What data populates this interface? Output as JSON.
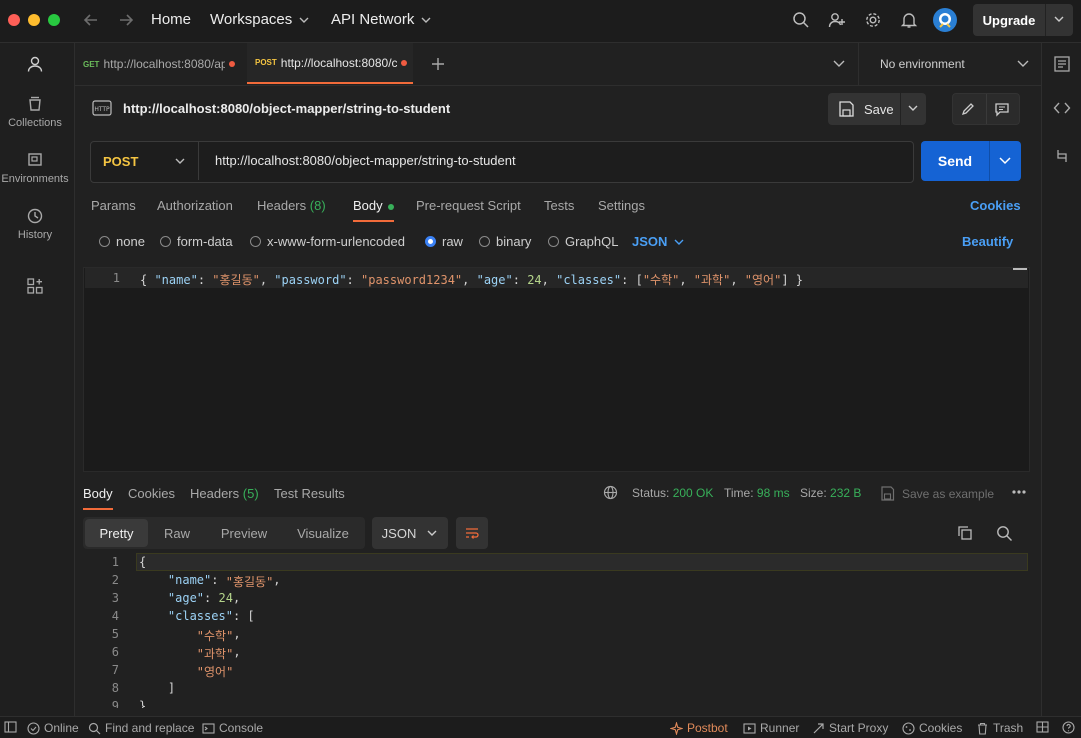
{
  "topbar": {
    "nav_home": "Home",
    "nav_workspaces": "Workspaces",
    "nav_api_network": "API Network",
    "upgrade_label": "Upgrade"
  },
  "sidebar": {
    "items": [
      {
        "label": "Collections"
      },
      {
        "label": "Environments"
      },
      {
        "label": "History"
      }
    ]
  },
  "tabs": [
    {
      "method": "GET",
      "title": "http://localhost:8080/ap",
      "method_color": "#6bbd5b"
    },
    {
      "method": "POST",
      "title": "http://localhost:8080/c",
      "method_color": "#f5c542"
    }
  ],
  "environment": {
    "selected": "No environment"
  },
  "request": {
    "title": "http://localhost:8080/object-mapper/string-to-student",
    "save_label": "Save",
    "method": "POST",
    "url": "http://localhost:8080/object-mapper/string-to-student",
    "send_label": "Send",
    "tabs": {
      "params": "Params",
      "authorization": "Authorization",
      "headers": "Headers",
      "headers_count": "(8)",
      "body": "Body",
      "prerequest": "Pre-request Script",
      "tests": "Tests",
      "settings": "Settings",
      "cookies": "Cookies"
    },
    "body_options": {
      "none": "none",
      "form_data": "form-data",
      "urlencoded": "x-www-form-urlencoded",
      "raw": "raw",
      "binary": "binary",
      "graphql": "GraphQL",
      "format": "JSON",
      "beautify": "Beautify"
    },
    "body_line_number": "1",
    "body_tokens": {
      "t1": "{ ",
      "t2": "\"name\"",
      "t3": ": ",
      "t4": "\"홍길동\"",
      "t5": ", ",
      "t6": "\"password\"",
      "t7": ": ",
      "t8": "\"password1234\"",
      "t9": ", ",
      "t10": "\"age\"",
      "t11": ": ",
      "t12": "24",
      "t13": ", ",
      "t14": "\"classes\"",
      "t15": ": [",
      "t16": "\"수학\"",
      "t17": ", ",
      "t18": "\"과학\"",
      "t19": ", ",
      "t20": "\"영어\"",
      "t21": "] }"
    }
  },
  "response": {
    "tabs": {
      "body": "Body",
      "cookies": "Cookies",
      "headers": "Headers",
      "headers_count": "(5)",
      "test_results": "Test Results"
    },
    "status_label": "Status:",
    "status_value": "200 OK",
    "time_label": "Time:",
    "time_value": "98 ms",
    "size_label": "Size:",
    "size_value": "232 B",
    "save_example": "Save as example",
    "views": {
      "pretty": "Pretty",
      "raw": "Raw",
      "preview": "Preview",
      "visualize": "Visualize"
    },
    "format": "JSON",
    "lines": [
      {
        "num": "1",
        "a": "{",
        "b": "",
        "c": "",
        "d": ""
      },
      {
        "num": "2",
        "a": "    ",
        "b": "\"name\"",
        "c": ": ",
        "d": "\"홍길동\"",
        "e": ","
      },
      {
        "num": "3",
        "a": "    ",
        "b": "\"age\"",
        "c": ": ",
        "d": "24",
        "e": ","
      },
      {
        "num": "4",
        "a": "    ",
        "b": "\"classes\"",
        "c": ": [",
        "d": "",
        "e": ""
      },
      {
        "num": "5",
        "a": "        ",
        "b": "",
        "c": "",
        "d": "\"수학\"",
        "e": ","
      },
      {
        "num": "6",
        "a": "        ",
        "b": "",
        "c": "",
        "d": "\"과학\"",
        "e": ","
      },
      {
        "num": "7",
        "a": "        ",
        "b": "",
        "c": "",
        "d": "\"영어\"",
        "e": ""
      },
      {
        "num": "8",
        "a": "    ]",
        "b": "",
        "c": "",
        "d": "",
        "e": ""
      },
      {
        "num": "9",
        "a": "}",
        "b": "",
        "c": "",
        "d": "",
        "e": ""
      }
    ]
  },
  "statusbar": {
    "online": "Online",
    "find_replace": "Find and replace",
    "console": "Console",
    "postbot": "Postbot",
    "runner": "Runner",
    "start_proxy": "Start Proxy",
    "cookies": "Cookies",
    "trash": "Trash"
  }
}
